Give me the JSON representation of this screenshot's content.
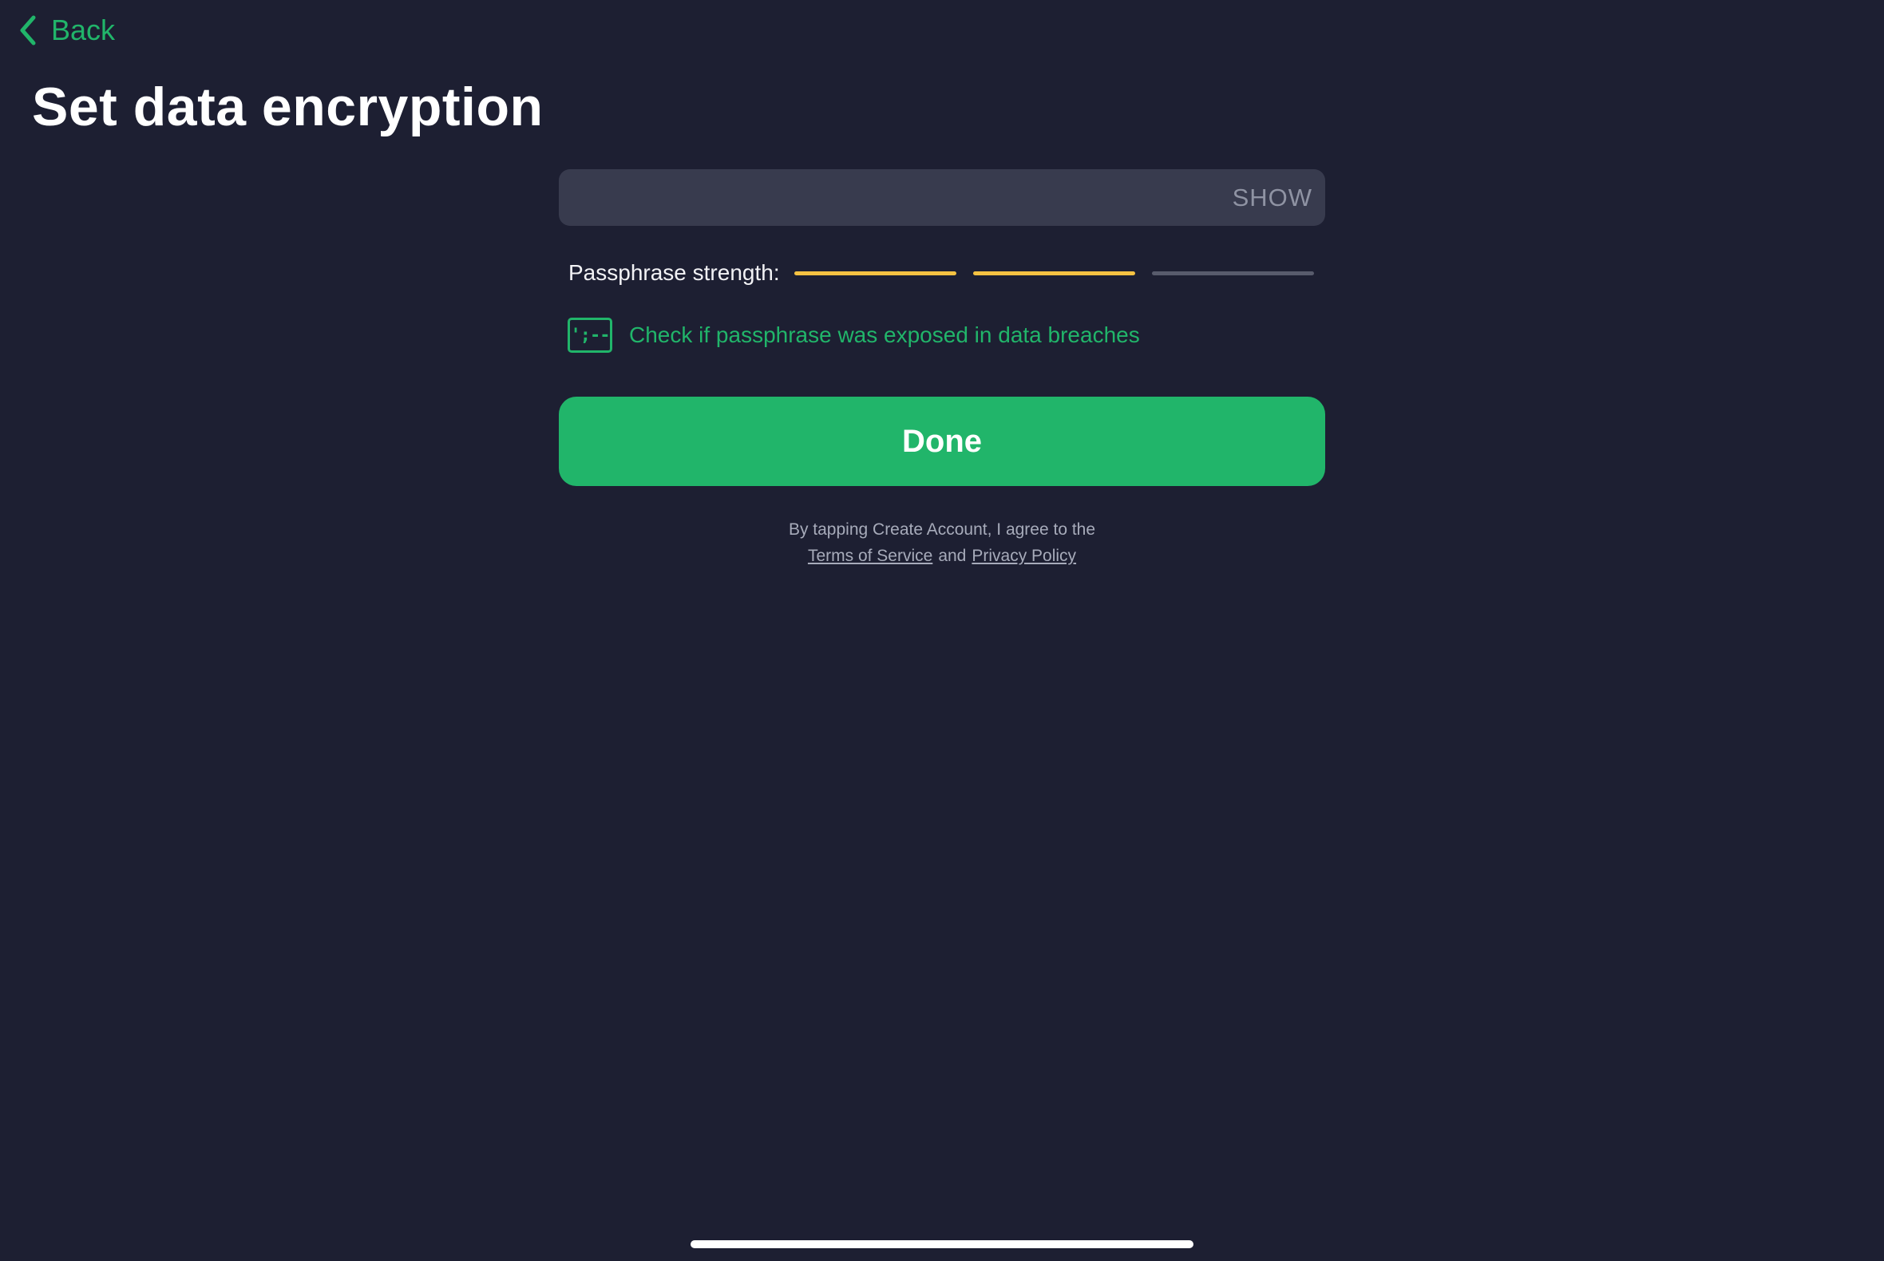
{
  "nav": {
    "back_label": "Back",
    "back_icon": "chevron-left-icon"
  },
  "header": {
    "title": "Set data encryption"
  },
  "passphrase": {
    "value": "",
    "show_label": "SHOW"
  },
  "strength": {
    "label": "Passphrase strength:",
    "segments_filled": 2,
    "segments_total": 3,
    "filled_color": "#f5c242",
    "empty_color": "#585b6c"
  },
  "breach_check": {
    "icon_text": "';--",
    "label": "Check if passphrase was exposed in data breaches"
  },
  "done_button": {
    "label": "Done"
  },
  "legal": {
    "line1": "By tapping Create Account, I agree to the",
    "terms_label": "Terms of Service",
    "and_text": "and",
    "privacy_label": "Privacy Policy"
  },
  "colors": {
    "background": "#1d1f32",
    "accent": "#21b56a",
    "field": "#383b4e"
  }
}
